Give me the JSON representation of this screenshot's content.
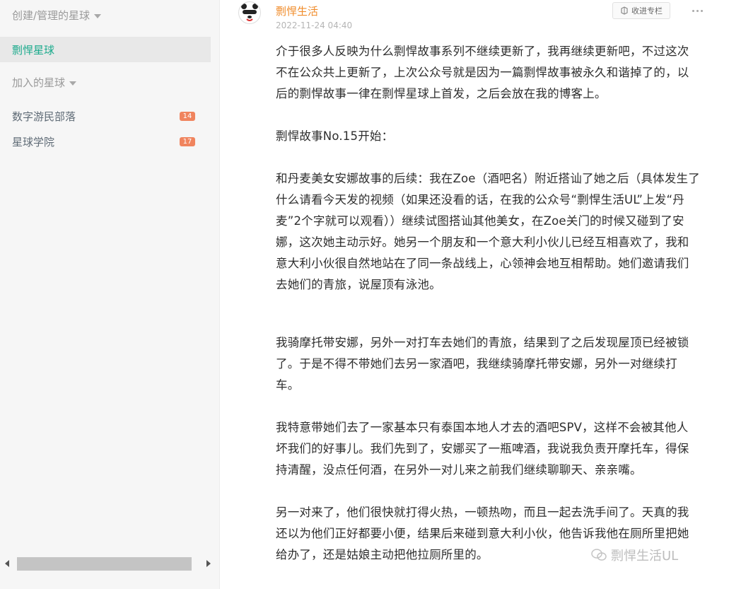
{
  "sidebar": {
    "created_header": "创建/管理的星球",
    "joined_header": "加入的星球",
    "created_items": [
      {
        "label": "剽悍星球"
      }
    ],
    "joined_items": [
      {
        "label": "数字游民部落",
        "badge": "14"
      },
      {
        "label": "星球学院",
        "badge": "17"
      }
    ]
  },
  "post": {
    "author": "剽悍生活",
    "time": "2022-11-24 04:40",
    "collect_label": "收进专栏",
    "paragraphs": [
      "介于很多人反映为什么剽悍故事系列不继续更新了，我再继续更新吧，不过这次不在公众共上更新了，上次公众号就是因为一篇剽悍故事被永久和谐掉了的，以后的剽悍故事一律在剽悍星球上首发，之后会放在我的博客上。",
      "剽悍故事No.15开始：",
      "和丹麦美女安娜故事的后续：我在Zoe（酒吧名）附近搭讪了她之后（具体发生了什么请看今天发的视频（如果还没看的话，在我的公众号“剽悍生活UL”上发“丹麦”2个字就可以观看））继续试图搭讪其他美女，在Zoe关门的时候又碰到了安娜，这次她主动示好。她另一个朋友和一个意大利小伙儿已经互相喜欢了，我和意大利小伙很自然地站在了同一条战线上，心领神会地互相帮助。她们邀请我们去她们的青旅，说屋顶有泳池。",
      "我骑摩托带安娜，另外一对打车去她们的青旅，结果到了之后发现屋顶已经被锁了。于是不得不带她们去另一家酒吧，我继续骑摩托带安娜，另外一对继续打车。",
      "我特意带她们去了一家基本只有泰国本地人才去的酒吧SPV，这样不会被其他人坏我们的好事儿。我们先到了，安娜买了一瓶啤酒，我说我负责开摩托车，得保持清醒，没点任何酒，在另外一对儿来之前我们继续聊聊天、亲亲嘴。",
      "另一对来了，他们很快就打得火热，一顿热吻，而且一起去洗手间了。天真的我还以为他们正好都要小便，结果后来碰到意大利小伙，他告诉我他在厕所里把她给办了，还是姑娘主动把他拉厕所里的。"
    ]
  },
  "watermarks": {
    "wechat_account": "剽悍生活UL"
  },
  "icons": {
    "caret": "caret-down-icon",
    "collect": "collect-icon",
    "more": "more-dots-icon",
    "wechat": "wechat-icon"
  },
  "colors": {
    "accent": "#1aaa8c",
    "author": "#f08c2b",
    "badge": "#f0845e"
  }
}
